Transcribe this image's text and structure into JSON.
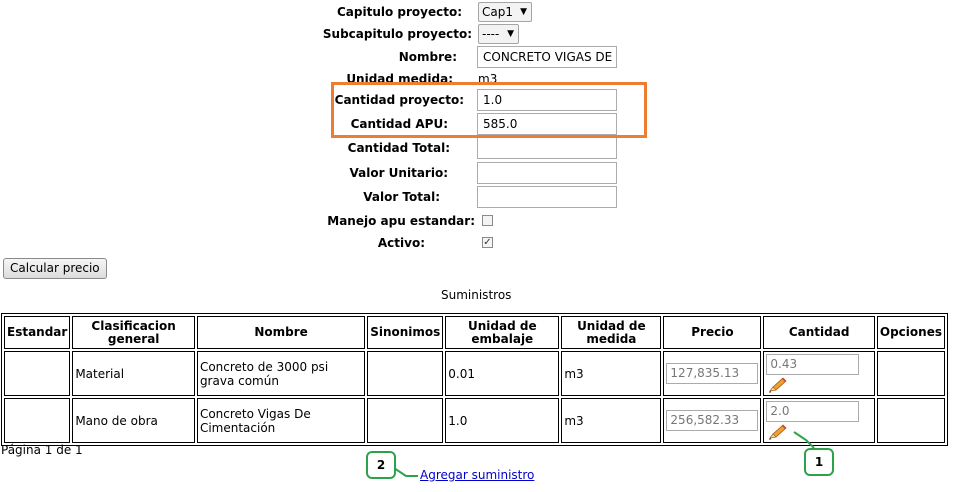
{
  "form": {
    "capitulo_label": "Capitulo proyecto:",
    "capitulo_value": "Cap1",
    "subcapitulo_label": "Subcapitulo proyecto:",
    "subcapitulo_value": "----",
    "nombre_label": "Nombre:",
    "nombre_value": "CONCRETO VIGAS DE C",
    "unidad_label": "Unidad medida:",
    "unidad_value": "m3",
    "cant_proyecto_label": "Cantidad proyecto:",
    "cant_proyecto_value": "1.0",
    "cant_apu_label": "Cantidad APU:",
    "cant_apu_value": "585.0",
    "cant_total_label": "Cantidad Total:",
    "cant_total_value": "",
    "valor_unitario_label": "Valor Unitario:",
    "valor_unitario_value": "",
    "valor_total_label": "Valor Total:",
    "valor_total_value": "",
    "manejo_label": "Manejo apu estandar:",
    "manejo_checked": false,
    "activo_label": "Activo:",
    "activo_checked": true
  },
  "calc_button": "Calcular precio",
  "table": {
    "caption": "Suministros",
    "headers": [
      "Estandar",
      "Clasificacion general",
      "Nombre",
      "Sinonimos",
      "Unidad de embalaje",
      "Unidad de medida",
      "Precio",
      "Cantidad",
      "Opciones"
    ],
    "rows": [
      {
        "estandar": "",
        "clasificacion": "Material",
        "nombre": "Concreto de 3000 psi grava común",
        "sinonimos": "",
        "embalaje": "0.01",
        "medida": "m3",
        "precio": "127,835.13",
        "cantidad": "0.43",
        "opciones": ""
      },
      {
        "estandar": "",
        "clasificacion": "Mano de obra",
        "nombre": "Concreto Vigas De Cimentación",
        "sinonimos": "",
        "embalaje": "1.0",
        "medida": "m3",
        "precio": "256,582.33",
        "cantidad": "2.0",
        "opciones": ""
      }
    ]
  },
  "pagination": "Página 1 de 1",
  "add_link": "Agregar suministro",
  "callouts": {
    "one": "1",
    "two": "2"
  },
  "colors": {
    "highlight": "#ed7d31",
    "callout": "#2ea24a",
    "link": "#0000cc"
  }
}
